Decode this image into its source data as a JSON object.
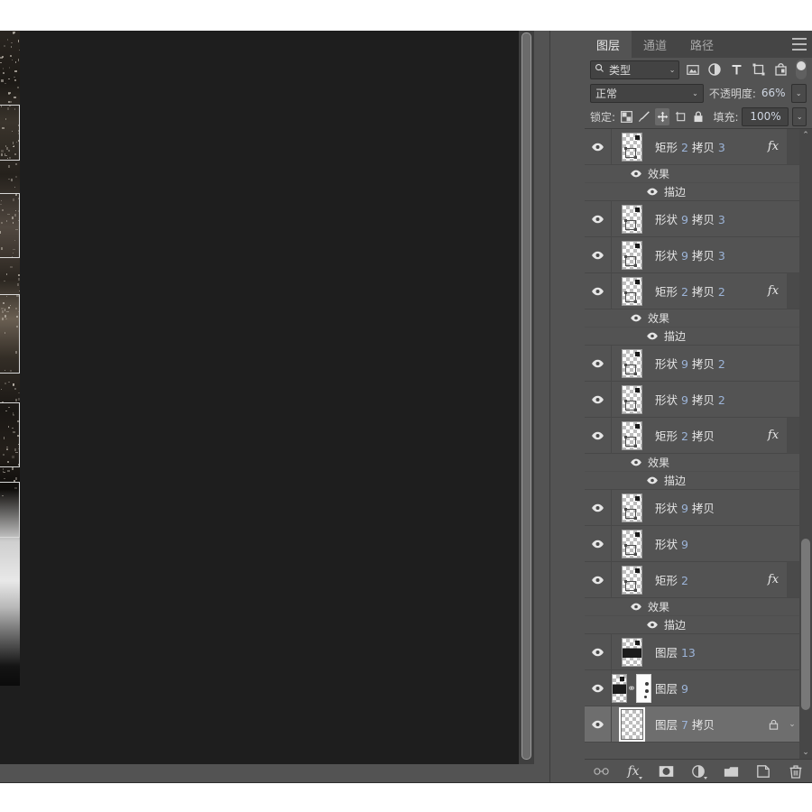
{
  "app": {
    "name": "photoshop",
    "colors": {
      "panel_bg": "#535353",
      "tab_bar_bg": "#454545",
      "canvas_bg": "#1e1e1e",
      "selected_row": "#6e6e6e",
      "accent_number": "#9cb4d8",
      "text": "#e6e6e6"
    }
  },
  "panel": {
    "tabs": [
      {
        "label": "图层",
        "active": true,
        "name": "tab-layers"
      },
      {
        "label": "通道",
        "active": false,
        "name": "tab-channels"
      },
      {
        "label": "路径",
        "active": false,
        "name": "tab-paths"
      }
    ],
    "menu_icon": "hamburger-menu-icon",
    "filter_row": {
      "search_icon": "search-icon",
      "kind_value": "类型",
      "kind_caret": "⌄",
      "filters": [
        {
          "name": "filter-pixel-layers-icon",
          "icon": "image-icon"
        },
        {
          "name": "filter-adjustment-layers-icon",
          "icon": "half-circle-icon"
        },
        {
          "name": "filter-type-layers-icon",
          "icon": "text-T-icon"
        },
        {
          "name": "filter-shape-layers-icon",
          "icon": "shape-bounds-icon"
        },
        {
          "name": "filter-smart-objects-icon",
          "icon": "smart-object-icon"
        }
      ],
      "toggle_name": "filter-enable-toggle"
    },
    "blend_row": {
      "blend_mode": "正常",
      "blend_caret": "⌄",
      "opacity_label": "不透明度:",
      "opacity_value": "66%",
      "opacity_caret": "⌄"
    },
    "lock_row": {
      "lock_label": "锁定:",
      "buttons": [
        {
          "name": "lock-transparent-pixels-icon",
          "icon": "checker-icon",
          "active": false
        },
        {
          "name": "lock-image-pixels-icon",
          "icon": "brush-icon",
          "active": false
        },
        {
          "name": "lock-position-icon",
          "icon": "move-arrows-icon",
          "active": true
        },
        {
          "name": "lock-artboard-nesting-icon",
          "icon": "artboard-icon",
          "active": false
        },
        {
          "name": "lock-all-icon",
          "icon": "padlock-icon",
          "active": false
        }
      ],
      "fill_label": "填充:",
      "fill_value": "100%",
      "fill_caret": "⌄"
    },
    "layers": [
      {
        "name": "矩形 2 拷贝 3",
        "base": "矩形",
        "num": "2",
        "suffix": "拷贝 3",
        "visible": true,
        "fx": "fx",
        "caret": "⌃",
        "selected": false,
        "thumb": "shape-transparent",
        "effects": {
          "group": "效果",
          "items": [
            "描边"
          ]
        }
      },
      {
        "name": "形状 9 拷贝 3",
        "base": "形状",
        "num": "9",
        "suffix": "拷贝 3",
        "visible": true,
        "fx": "",
        "caret": "",
        "selected": false,
        "thumb": "shape-transparent",
        "effects": null
      },
      {
        "name": "形状 9 拷贝 3",
        "base": "形状",
        "num": "9",
        "suffix": "拷贝 3",
        "visible": true,
        "fx": "",
        "caret": "",
        "selected": false,
        "thumb": "shape-transparent",
        "effects": null
      },
      {
        "name": "矩形 2 拷贝 2",
        "base": "矩形",
        "num": "2",
        "suffix": "拷贝 2",
        "visible": true,
        "fx": "fx",
        "caret": "⌃",
        "selected": false,
        "thumb": "shape-transparent",
        "effects": {
          "group": "效果",
          "items": [
            "描边"
          ]
        }
      },
      {
        "name": "形状 9 拷贝 2",
        "base": "形状",
        "num": "9",
        "suffix": "拷贝 2",
        "visible": true,
        "fx": "",
        "caret": "",
        "selected": false,
        "thumb": "shape-transparent",
        "effects": null
      },
      {
        "name": "形状 9 拷贝 2",
        "base": "形状",
        "num": "9",
        "suffix": "拷贝 2",
        "visible": true,
        "fx": "",
        "caret": "",
        "selected": false,
        "thumb": "shape-transparent",
        "effects": null
      },
      {
        "name": "矩形 2 拷贝",
        "base": "矩形",
        "num": "2",
        "suffix": "拷贝",
        "visible": true,
        "fx": "fx",
        "caret": "⌃",
        "selected": false,
        "thumb": "shape-transparent",
        "effects": {
          "group": "效果",
          "items": [
            "描边"
          ]
        }
      },
      {
        "name": "形状 9 拷贝",
        "base": "形状",
        "num": "9",
        "suffix": "拷贝",
        "visible": true,
        "fx": "",
        "caret": "",
        "selected": false,
        "thumb": "shape-transparent",
        "effects": null
      },
      {
        "name": "形状 9",
        "base": "形状",
        "num": "9",
        "suffix": "",
        "visible": true,
        "fx": "",
        "caret": "",
        "selected": false,
        "thumb": "shape-transparent",
        "effects": null
      },
      {
        "name": "矩形 2",
        "base": "矩形",
        "num": "2",
        "suffix": "",
        "visible": true,
        "fx": "fx",
        "caret": "⌃",
        "selected": false,
        "thumb": "shape-transparent",
        "effects": {
          "group": "效果",
          "items": [
            "描边"
          ]
        }
      },
      {
        "name": "图层 13",
        "base": "图层",
        "num": "13",
        "suffix": "",
        "visible": true,
        "fx": "",
        "caret": "",
        "selected": false,
        "thumb": "inked-transparent",
        "effects": null
      },
      {
        "name": "图层 9",
        "base": "图层",
        "num": "9",
        "suffix": "",
        "visible": true,
        "fx": "",
        "caret": "",
        "selected": false,
        "thumb": "inked-transparent",
        "has_mask": true,
        "effects": null
      },
      {
        "name": "图层 7 拷贝",
        "base": "图层",
        "num": "7",
        "suffix": "拷贝",
        "visible": true,
        "fx": "",
        "caret": "⌄",
        "selected": true,
        "locked": true,
        "thumb": "empty-transparent",
        "effects": null
      }
    ],
    "scrollbar": {
      "up_arrow": "⌃",
      "down_arrow": "⌄",
      "name": "layers-scrollbar"
    },
    "footer_buttons": [
      {
        "name": "link-layers-button",
        "icon": "chain-link-icon",
        "label": ""
      },
      {
        "name": "add-layer-style-button",
        "icon": "fx-icon",
        "label": "fx"
      },
      {
        "name": "add-layer-mask-button",
        "icon": "mask-icon",
        "label": ""
      },
      {
        "name": "new-fill-adjustment-button",
        "icon": "half-circle-icon",
        "label": ""
      },
      {
        "name": "new-group-button",
        "icon": "folder-icon",
        "label": ""
      },
      {
        "name": "new-layer-button",
        "icon": "new-layer-icon",
        "label": ""
      },
      {
        "name": "delete-layer-button",
        "icon": "trash-icon",
        "label": ""
      }
    ]
  }
}
